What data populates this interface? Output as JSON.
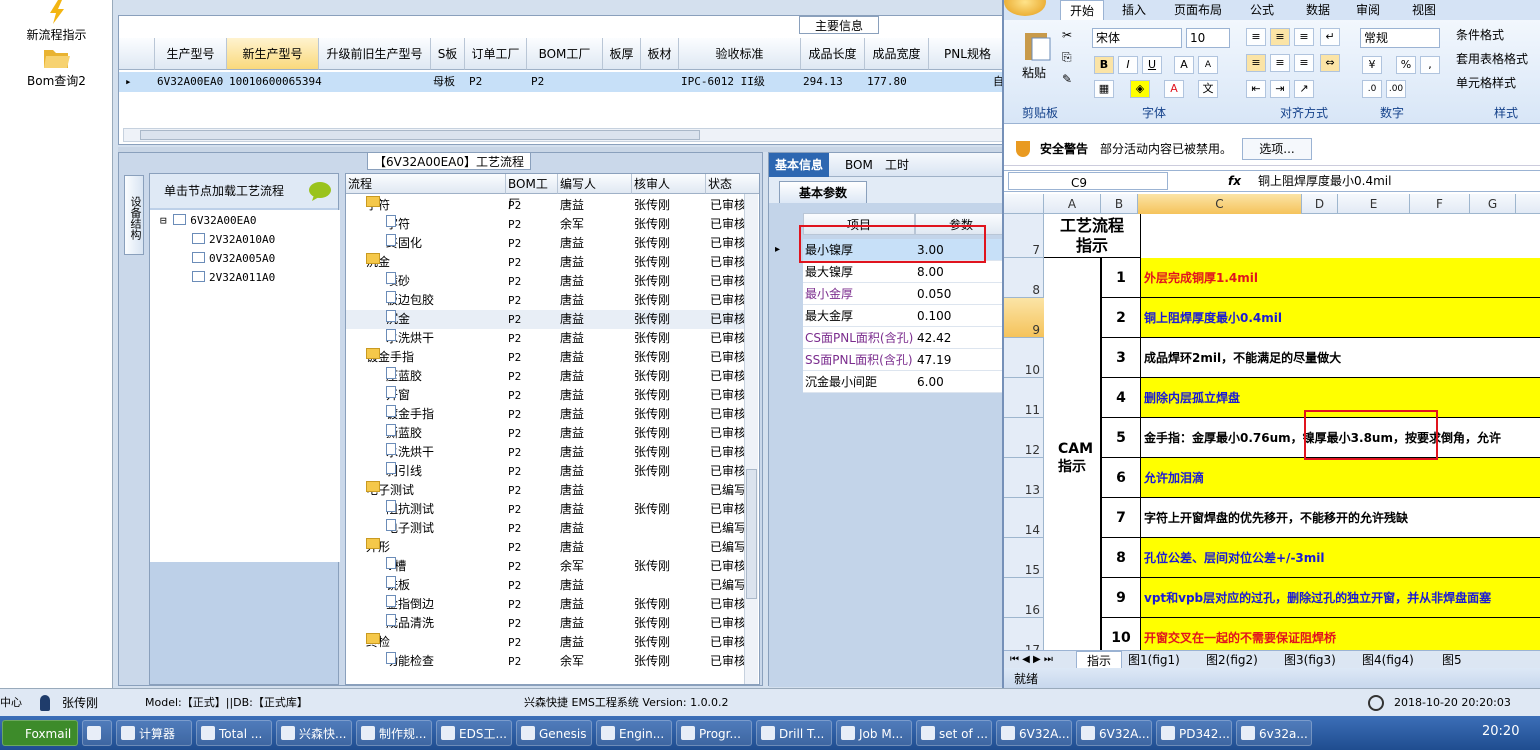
{
  "leftnav": {
    "items": [
      {
        "label": "新流程指示",
        "icon": "lightning-icon"
      },
      {
        "label": "Bom查询2",
        "icon": "folder-open-icon"
      }
    ]
  },
  "topgrid": {
    "title": "主要信息",
    "columns": [
      "生产型号",
      "新生产型号",
      "升级前旧生产型号",
      "S板",
      "订单工厂",
      "BOM工厂",
      "板厚",
      "板材",
      "验收标准",
      "成品长度",
      "成品宽度",
      "PNL规格"
    ],
    "row": {
      "model": "6V32A00EA0",
      "new_model": "10010600065394",
      "s_board": "母板",
      "order_factory": "P2",
      "bom_factory": "P2",
      "standard": "IPC-6012 II级",
      "length": "294.13",
      "width": "177.80",
      "extra": "自"
    }
  },
  "process": {
    "title": "【6V32A00EA0】工艺流程",
    "vtab": "设备结构",
    "tree_header": "单击节点加载工艺流程",
    "tree": [
      "6V32A00EA0",
      "2V32A010A0",
      "0V32A005A0",
      "2V32A011A0"
    ],
    "columns": [
      "流程",
      "BOM工厂",
      "编写人",
      "核审人",
      "状态"
    ],
    "rows": [
      {
        "name": "字符",
        "level": 0,
        "factory": "P2",
        "writer": "唐益",
        "reviewer": "张传刚",
        "status": "已审核"
      },
      {
        "name": "字符",
        "level": 1,
        "factory": "P2",
        "writer": "余军",
        "reviewer": "张传刚",
        "status": "已审核"
      },
      {
        "name": "终固化",
        "level": 1,
        "factory": "P2",
        "writer": "唐益",
        "reviewer": "张传刚",
        "status": "已审核"
      },
      {
        "name": "沉金",
        "level": 0,
        "factory": "P2",
        "writer": "唐益",
        "reviewer": "张传刚",
        "status": "已审核"
      },
      {
        "name": "喷砂",
        "level": 1,
        "factory": "P2",
        "writer": "唐益",
        "reviewer": "张传刚",
        "status": "已审核"
      },
      {
        "name": "板边包胶",
        "level": 1,
        "factory": "P2",
        "writer": "唐益",
        "reviewer": "张传刚",
        "status": "已审核"
      },
      {
        "name": "沉金",
        "level": 1,
        "factory": "P2",
        "writer": "唐益",
        "reviewer": "张传刚",
        "status": "已审核"
      },
      {
        "name": "水洗烘干",
        "level": 1,
        "factory": "P2",
        "writer": "唐益",
        "reviewer": "张传刚",
        "status": "已审核"
      },
      {
        "name": "镀金手指",
        "level": 0,
        "factory": "P2",
        "writer": "唐益",
        "reviewer": "张传刚",
        "status": "已审核"
      },
      {
        "name": "压蓝胶",
        "level": 1,
        "factory": "P2",
        "writer": "唐益",
        "reviewer": "张传刚",
        "status": "已审核"
      },
      {
        "name": "开窗",
        "level": 1,
        "factory": "P2",
        "writer": "唐益",
        "reviewer": "张传刚",
        "status": "已审核"
      },
      {
        "name": "镀金手指",
        "level": 1,
        "factory": "P2",
        "writer": "唐益",
        "reviewer": "张传刚",
        "status": "已审核"
      },
      {
        "name": "撕蓝胶",
        "level": 1,
        "factory": "P2",
        "writer": "唐益",
        "reviewer": "张传刚",
        "status": "已审核"
      },
      {
        "name": "水洗烘干",
        "level": 1,
        "factory": "P2",
        "writer": "唐益",
        "reviewer": "张传刚",
        "status": "已审核"
      },
      {
        "name": "剥引线",
        "level": 1,
        "factory": "P2",
        "writer": "唐益",
        "reviewer": "张传刚",
        "status": "已审核"
      },
      {
        "name": "电子测试",
        "level": 0,
        "factory": "P2",
        "writer": "唐益",
        "reviewer": "",
        "status": "已编写"
      },
      {
        "name": "阻抗测试",
        "level": 1,
        "factory": "P2",
        "writer": "唐益",
        "reviewer": "张传刚",
        "status": "已审核"
      },
      {
        "name": "电子测试",
        "level": 1,
        "factory": "P2",
        "writer": "唐益",
        "reviewer": "",
        "status": "已编写"
      },
      {
        "name": "外形",
        "level": 0,
        "factory": "P2",
        "writer": "唐益",
        "reviewer": "",
        "status": "已编写"
      },
      {
        "name": "V槽",
        "level": 1,
        "factory": "P2",
        "writer": "余军",
        "reviewer": "张传刚",
        "status": "已审核"
      },
      {
        "name": "铣板",
        "level": 1,
        "factory": "P2",
        "writer": "唐益",
        "reviewer": "",
        "status": "已编写"
      },
      {
        "name": "金指倒边",
        "level": 1,
        "factory": "P2",
        "writer": "唐益",
        "reviewer": "张传刚",
        "status": "已审核"
      },
      {
        "name": "成品清洗",
        "level": 1,
        "factory": "P2",
        "writer": "唐益",
        "reviewer": "张传刚",
        "status": "已审核"
      },
      {
        "name": "终检",
        "level": 0,
        "factory": "P2",
        "writer": "唐益",
        "reviewer": "张传刚",
        "status": "已审核"
      },
      {
        "name": "功能检查",
        "level": 1,
        "factory": "P2",
        "writer": "余军",
        "reviewer": "张传刚",
        "status": "已审核"
      }
    ]
  },
  "basic": {
    "tabs": [
      "基本信息",
      "BOM",
      "工时"
    ],
    "subtab": "基本参数",
    "columns": [
      "项目",
      "参数"
    ],
    "rows": [
      {
        "item": "最小镍厚",
        "value": "3.00",
        "color": "#000000"
      },
      {
        "item": "最大镍厚",
        "value": "8.00",
        "color": "#000000"
      },
      {
        "item": "最小金厚",
        "value": "0.050",
        "color": "#7b2d8e"
      },
      {
        "item": "最大金厚",
        "value": "0.100",
        "color": "#000000"
      },
      {
        "item": "CS面PNL面积(含孔)",
        "value": "42.42",
        "color": "#7b2d8e"
      },
      {
        "item": "SS面PNL面积(含孔)",
        "value": "47.19",
        "color": "#7b2d8e"
      },
      {
        "item": "沉金最小间距",
        "value": "6.00",
        "color": "#000000"
      }
    ]
  },
  "status": {
    "left": "中心",
    "user": "张传刚",
    "model": "Model:【正式】||DB:【正式库】",
    "app": "兴森快捷 EMS工程系统 Version: 1.0.0.2",
    "datetime": "2018-10-20 20:20:03"
  },
  "taskbar": {
    "items": [
      "Foxmail",
      "",
      "计算器",
      "Total ...",
      "兴森快...",
      "制作规...",
      "EDS工...",
      "Genesis",
      "Engin...",
      "Progr...",
      "Drill T...",
      "Job M...",
      "set of ...",
      "6V32A...",
      "6V32A...",
      "PD342...",
      "6v32a..."
    ],
    "time": "20:20"
  },
  "excel": {
    "tabs": [
      "开始",
      "插入",
      "页面布局",
      "公式",
      "数据",
      "审阅",
      "视图"
    ],
    "font": "宋体",
    "size": "10",
    "numfmt": "常规",
    "groups": [
      "剪贴板",
      "字体",
      "对齐方式",
      "数字",
      "样式"
    ],
    "paste": "粘贴",
    "styles": [
      "条件格式",
      "套用表格格式",
      "单元格样式"
    ],
    "security": {
      "title": "安全警告",
      "msg": "部分活动内容已被禁用。",
      "btn": "选项..."
    },
    "cellref": "C9",
    "fx": "fx",
    "formula": "铜上阻焊厚度最小0.4mil",
    "cols": [
      "A",
      "B",
      "C",
      "D",
      "E",
      "F",
      "G"
    ],
    "header_cell": "工艺流程指示",
    "cam_label": "CAM指示",
    "rows": [
      "7",
      "8",
      "9",
      "10",
      "11",
      "12",
      "13",
      "14",
      "15",
      "16",
      "17"
    ],
    "items": [
      {
        "n": "1",
        "text": "外层完成铜厚1.4mil",
        "color": "#e0141e",
        "bg": "#ffff00"
      },
      {
        "n": "2",
        "text": "铜上阻焊厚度最小0.4mil",
        "color": "#1a1ad6",
        "bg": "#ffff00"
      },
      {
        "n": "3",
        "text": "成品焊环2mil，不能满足的尽量做大",
        "color": "#000000",
        "bg": "#ffffff"
      },
      {
        "n": "4",
        "text": "删除内层孤立焊盘",
        "color": "#1a1ad6",
        "bg": "#ffff00"
      },
      {
        "n": "5",
        "text": "金手指：金厚最小0.76um，镍厚最小3.8um，按要求倒角，允许",
        "color": "#000000",
        "bg": "#ffffff"
      },
      {
        "n": "6",
        "text": "允许加泪滴",
        "color": "#1a1ad6",
        "bg": "#ffff00"
      },
      {
        "n": "7",
        "text": "字符上开窗焊盘的优先移开，不能移开的允许残缺",
        "color": "#000000",
        "bg": "#ffffff"
      },
      {
        "n": "8",
        "text": "孔位公差、层间对位公差+/-3mil",
        "color": "#1a1ad6",
        "bg": "#ffff00"
      },
      {
        "n": "9",
        "text": "vpt和vpb层对应的过孔，删除过孔的独立开窗，并从非焊盘面塞",
        "color": "#1a1ad6",
        "bg": "#ffff00"
      },
      {
        "n": "10",
        "text": "开窗交叉在一起的不需要保证阻焊桥",
        "color": "#e0141e",
        "bg": "#ffff00"
      }
    ],
    "sheets": [
      "指示",
      "图1(fig1)",
      "图2(fig2)",
      "图3(fig3)",
      "图4(fig4)",
      "图5"
    ],
    "statusbar": "就绪"
  }
}
